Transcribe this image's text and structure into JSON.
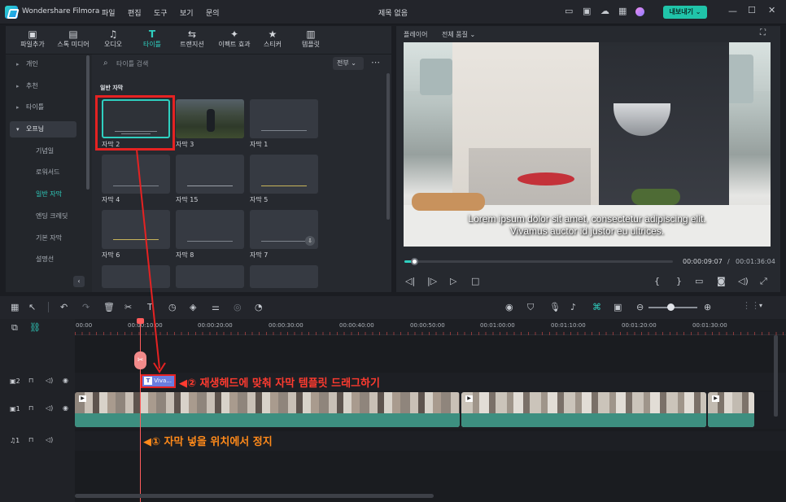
{
  "window": {
    "app_name": "Wondershare Filmora",
    "title": "제목 없음",
    "export_label": "내보내기"
  },
  "menu": [
    "파일",
    "편집",
    "도구",
    "보기",
    "문의"
  ],
  "media_toolbar": [
    {
      "label": "파일추가",
      "icon": "import-icon"
    },
    {
      "label": "스톡 미디어",
      "icon": "stock-media-icon"
    },
    {
      "label": "오디오",
      "icon": "audio-icon"
    },
    {
      "label": "타이틀",
      "icon": "title-icon",
      "active": true
    },
    {
      "label": "트랜지션",
      "icon": "transition-icon"
    },
    {
      "label": "이펙트 효과",
      "icon": "effects-icon"
    },
    {
      "label": "스티커",
      "icon": "sticker-icon"
    },
    {
      "label": "템플릿",
      "icon": "template-icon"
    }
  ],
  "sidebar": {
    "items": [
      {
        "label": "개인"
      },
      {
        "label": "추천"
      },
      {
        "label": "타이틀"
      },
      {
        "label": "오프닝"
      },
      {
        "label": "기념일"
      },
      {
        "label": "로워서드"
      },
      {
        "label": "일반 자막"
      },
      {
        "label": "엔딩 크레딧"
      },
      {
        "label": "기본 자막"
      },
      {
        "label": "설명선"
      }
    ]
  },
  "search": {
    "placeholder": "타이틀 검색",
    "filter": "전부"
  },
  "section_title": "일반 자막",
  "templates": [
    {
      "label": "자막 2"
    },
    {
      "label": "자막 3"
    },
    {
      "label": "자막 1"
    },
    {
      "label": "자막 4"
    },
    {
      "label": "자막 15"
    },
    {
      "label": "자막 5"
    },
    {
      "label": "자막 6"
    },
    {
      "label": "자막 8"
    },
    {
      "label": "자막 7"
    }
  ],
  "player": {
    "label": "플레이어",
    "quality": "전체 품질",
    "subtitle_line1": "Lorem ipsum dolor sit amet, consectetur adipiscing elit.",
    "subtitle_line2": "Vivamus auctor id justor eu ultrices.",
    "current_time": "00:00:09:07",
    "total_time": "00:01:36:04",
    "progress": 0.035
  },
  "ruler": [
    "00:00",
    "00:00:10:00",
    "00:00:20:00",
    "00:00:30:00",
    "00:00:40:00",
    "00:00:50:00",
    "00:01:00:00",
    "00:01:10:00",
    "00:01:20:00",
    "00:01:30:00"
  ],
  "tracks": {
    "title_clip_label": "Viva...",
    "title_track_num": "2",
    "video_track_num": "1",
    "audio_track_num": "1"
  },
  "callouts": {
    "step1": "◀① 자막 넣을 위치에서 정지",
    "step2": "◀② 재생헤드에 맞춰 자막 템플릿 드래그하기"
  },
  "colors": {
    "accent": "#2fd0c0",
    "callout_red": "#ff3b30",
    "callout_orange": "#ff8a1a",
    "playhead": "#ff5c5c"
  }
}
